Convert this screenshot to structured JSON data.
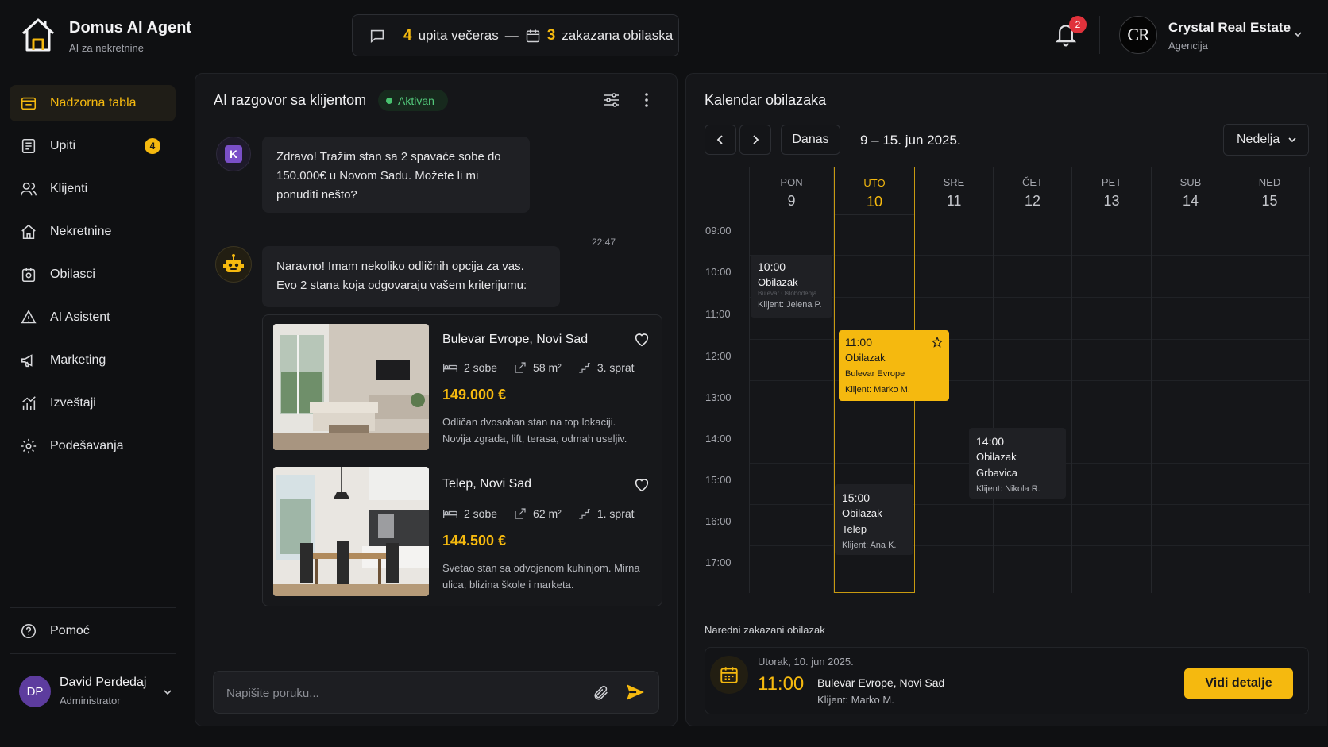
{
  "brand": {
    "name": "Domus AI Agent",
    "subtitle": "AI za nekretnine"
  },
  "summary": {
    "inquiries_count": "4",
    "inquiries_text": "upita večeras",
    "separator": "—",
    "visits_count": "3",
    "visits_text": "zakazana obilaska"
  },
  "notifications": {
    "count": "2"
  },
  "agency": {
    "initials": "CR",
    "name": "Crystal Real Estate",
    "role": "Agencija"
  },
  "sidebar": {
    "items": [
      {
        "label": "Nadzorna tabla",
        "icon": "dashboard-icon",
        "active": true
      },
      {
        "label": "Upiti",
        "icon": "inbox-icon",
        "badge": "4"
      },
      {
        "label": "Klijenti",
        "icon": "users-icon"
      },
      {
        "label": "Nekretnine",
        "icon": "home-icon"
      },
      {
        "label": "Obilasci",
        "icon": "calendar-check-icon"
      },
      {
        "label": "AI Asistent",
        "icon": "ai-icon"
      },
      {
        "label": "Marketing",
        "icon": "megaphone-icon"
      },
      {
        "label": "Izveštaji",
        "icon": "chart-icon"
      },
      {
        "label": "Podešavanja",
        "icon": "gear-icon"
      }
    ],
    "help_label": "Pomoć"
  },
  "user": {
    "initials": "DP",
    "name": "David Perdedaj",
    "role": "Administrator"
  },
  "chat": {
    "title": "AI razgovor sa klijentom",
    "status": "Aktivan",
    "client_initial": "K",
    "client_message": "Zdravo! Tražim stan sa 2 spavaće sobe do 150.000€ u Novom Sadu. Možete li mi ponuditi nešto?",
    "time": "22:47",
    "ai_message": "Naravno! Imam nekoliko odličnih opcija za vas. Evo 2 stana koja odgovaraju vašem kriterijumu:",
    "properties": [
      {
        "title": "Bulevar Evrope, Novi Sad",
        "rooms": "2 sobe",
        "area": "58 m²",
        "floor": "3. sprat",
        "price": "149.000 €",
        "description": "Odličan dvosoban stan na top lokaciji. Novija zgrada, lift, terasa, odmah useljiv."
      },
      {
        "title": "Telep, Novi Sad",
        "rooms": "2 sobe",
        "area": "62 m²",
        "floor": "1. sprat",
        "price": "144.500 €",
        "description": "Svetao stan sa odvojenom kuhinjom. Mirna ulica, blizina škole i marketa."
      }
    ],
    "input_placeholder": "Napišite poruku..."
  },
  "calendar": {
    "title": "Kalendar obilazaka",
    "today_label": "Danas",
    "range": "9 – 15. jun 2025.",
    "view": "Nedelja",
    "days": [
      {
        "abbr": "PON",
        "num": "9"
      },
      {
        "abbr": "UTO",
        "num": "10",
        "today": true
      },
      {
        "abbr": "SRE",
        "num": "11"
      },
      {
        "abbr": "ČET",
        "num": "12"
      },
      {
        "abbr": "PET",
        "num": "13"
      },
      {
        "abbr": "SUB",
        "num": "14"
      },
      {
        "abbr": "NED",
        "num": "15"
      }
    ],
    "hours": [
      "09:00",
      "10:00",
      "11:00",
      "12:00",
      "13:00",
      "14:00",
      "15:00",
      "16:00",
      "17:00"
    ],
    "events": [
      {
        "time": "10:00",
        "type": "Obilazak",
        "location": "Bulevar Oslobođenja",
        "client": "Klijent: Jelena P."
      },
      {
        "time": "11:00",
        "type": "Obilazak",
        "location": "Bulevar Evrope",
        "client": "Klijent: Marko M."
      },
      {
        "time": "14:00",
        "type": "Obilazak",
        "location": "Grbavica",
        "client": "Klijent: Nikola R."
      },
      {
        "time": "15:00",
        "type": "Obilazak",
        "location": "Telep",
        "client": "Klijent: Ana K."
      }
    ],
    "next": {
      "label": "Naredni zakazani obilazak",
      "date": "Utorak, 10. jun 2025.",
      "time": "11:00",
      "address": "Bulevar Evrope, Novi Sad",
      "client": "Klijent: Marko M.",
      "button": "Vidi detalje"
    }
  },
  "colors": {
    "accent": "#f5b90f",
    "success": "#48c26f",
    "danger": "#e0323b",
    "background": "#0f1012"
  }
}
